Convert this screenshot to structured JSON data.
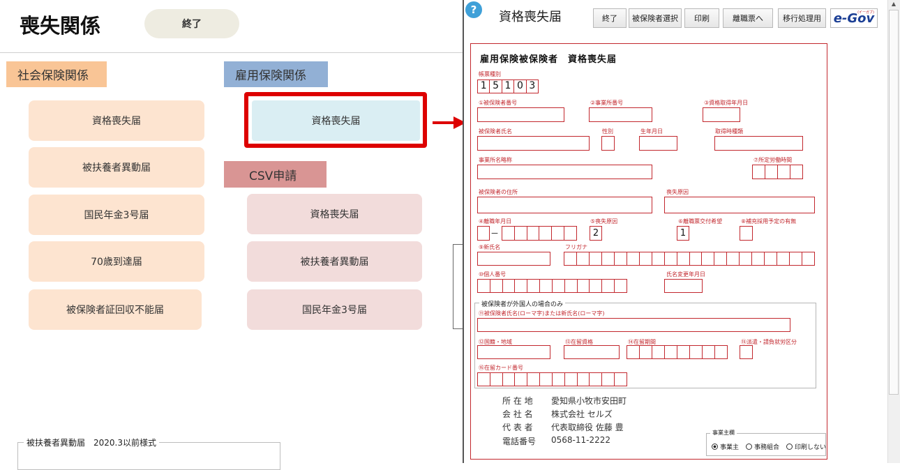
{
  "left": {
    "title": "喪失関係",
    "end_button": "終了",
    "social": {
      "header": "社会保険関係",
      "buttons": [
        "資格喪失届",
        "被扶養者異動届",
        "国民年金3号届",
        "70歳到達届",
        "被保険者証回収不能届"
      ]
    },
    "employment": {
      "header": "雇用保険関係",
      "buttons": [
        "資格喪失届"
      ]
    },
    "csv": {
      "header": "CSV申請",
      "buttons": [
        "資格喪失届",
        "被扶養者異動届",
        "国民年金3号届"
      ]
    },
    "bottom_group": "被扶養者異動届　2020.3以前様式"
  },
  "form_window": {
    "help_icon": "?",
    "title": "資格喪失届",
    "toolbar": [
      "終了",
      "被保険者選択",
      "印刷",
      "離職票へ",
      "移行処理用"
    ],
    "egov_logo": "e-Gov",
    "egov_small": "(イーガブ)",
    "doc_title": "雇用保険被保険者　資格喪失届",
    "form_type_label": "帳票種別",
    "form_type_digits": [
      "1",
      "5",
      "1",
      "0",
      "3"
    ],
    "fields": {
      "insured_no": "①被保険者番号",
      "office_no": "②事業所番号",
      "acq_date": "③資格取得年月日",
      "name": "被保険者氏名",
      "gender": "性別",
      "birth": "生年月日",
      "acq_type": "取得時種類",
      "office_short": "事業所名略称",
      "work_hours": "⑦所定労働時間",
      "address": "被保険者の住所",
      "loss_reason_title": "喪失原因",
      "leave_date": "④離職年月日",
      "loss_reason": "⑤喪失原因",
      "sep_request": "⑥離職票交付希望",
      "replacement": "⑧補充採用予定の有無",
      "new_name": "⑨新氏名",
      "furigana": "フリガナ",
      "my_number": "⑩個人番号",
      "name_change_date": "氏名変更年月日",
      "foreign_group": "被保険者が外国人の場合のみ",
      "roman_name": "⑪被保険者氏名(ローマ字)または新氏名(ローマ字)",
      "nationality": "⑫国籍・地域",
      "status": "⑬在留資格",
      "period": "⑭在留期間",
      "dispatch": "⑮派遣・請負就労区分",
      "card_no": "⑯在留カード番号"
    },
    "values": {
      "dash": "－",
      "loss_reason": "2",
      "sep_request": "1"
    },
    "employer": {
      "rows": [
        {
          "label": "所 在 地",
          "value": "愛知県小牧市安田町"
        },
        {
          "label": "会 社 名",
          "value": "株式会社 セルズ"
        },
        {
          "label": "代 表 者",
          "value": "代表取締役 佐藤 豊"
        },
        {
          "label": "電話番号",
          "value": "0568-11-2222"
        }
      ]
    },
    "owner_box": {
      "title": "事業主欄",
      "options": [
        "事業主",
        "事務組合",
        "印刷しない"
      ],
      "selected": "事業主"
    }
  },
  "colors": {
    "social": "#fde4d0",
    "social_header": "#f9c596",
    "employment_header": "#92b0d5",
    "employment_button": "#daeef3",
    "csv_header": "#d99594",
    "csv_button": "#f2dcdb",
    "highlight": "#dd0000"
  }
}
